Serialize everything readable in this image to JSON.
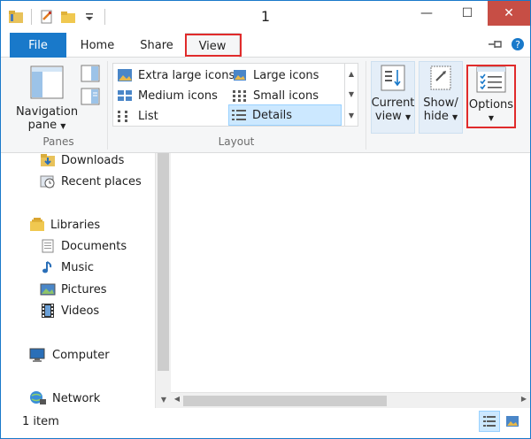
{
  "window": {
    "title": "1"
  },
  "title_buttons": {
    "minimize": "—",
    "maximize": "☐",
    "close": "✕"
  },
  "tabs": {
    "file": "File",
    "home": "Home",
    "share": "Share",
    "view": "View"
  },
  "ribbon": {
    "panes": {
      "navigation_pane_line1": "Navigation",
      "navigation_pane_line2": "pane",
      "group_label": "Panes"
    },
    "layout": {
      "group_label": "Layout",
      "items": [
        "Extra large icons",
        "Large icons",
        "Medium icons",
        "Small icons",
        "List",
        "Details"
      ],
      "selected": "Details"
    },
    "current_view": {
      "line1": "Current",
      "line2": "view"
    },
    "show_hide": {
      "line1": "Show/",
      "line2": "hide"
    },
    "options": {
      "label": "Options"
    }
  },
  "nav": {
    "items": [
      "Downloads",
      "Recent places",
      "Libraries",
      "Documents",
      "Music",
      "Pictures",
      "Videos",
      "Computer",
      "Network"
    ]
  },
  "status": {
    "item_count": "1 item"
  }
}
